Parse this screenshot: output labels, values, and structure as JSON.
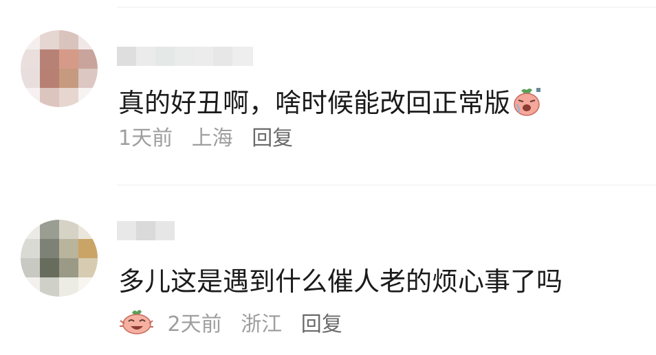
{
  "comments": [
    {
      "text": "真的好丑啊，啥时候能改回正常版",
      "time": "1天前",
      "location": "上海",
      "reply_label": "回复",
      "emoji": "radish-crying-emoji"
    },
    {
      "text": "多儿这是遇到什么催人老的烦心事了吗",
      "time": "2天前",
      "location": "浙江",
      "reply_label": "回复",
      "emoji": "radish-laughing-emoji"
    }
  ]
}
